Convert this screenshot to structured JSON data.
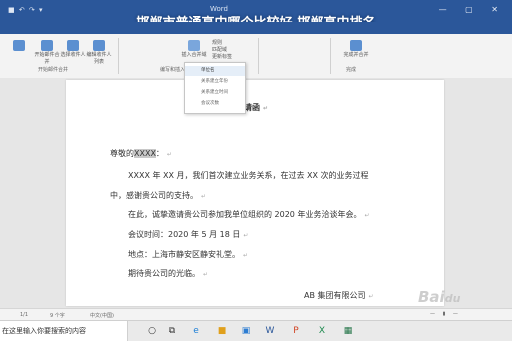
{
  "overlay_title": "邯郸市普通高中哪个比较好,邯郸高中排名",
  "window": {
    "title": "Word"
  },
  "ribbon": {
    "buttons": [
      "开始邮件合并",
      "选择收件人",
      "编辑收件人列表",
      "插入合并域"
    ],
    "group_labels": [
      "开始邮件合并",
      "编写和插入域",
      "完成"
    ],
    "right_items": [
      "规则",
      "匹配域",
      "更新标签"
    ],
    "finish_label": "完成并合并"
  },
  "dropdown": {
    "items": [
      "单位名",
      "关系建立年份",
      "关系建立时间",
      "会议次数"
    ],
    "selected_index": 0
  },
  "document": {
    "title": "邀请函",
    "salutation_prefix": "尊敬的",
    "salutation_field": "XXXX",
    "salutation_suffix": "：",
    "para1_line1": "XXXX 年 XX 月，我们首次建立业务关系，在过去 XX 次的业务过程",
    "para1_line2": "中，感谢贵公司的支持。",
    "para2": "在此，诚挚邀请贵公司参加我单位组织的 2020 年业务洽谈年会。",
    "time_line": "会议时间：2020 年 5 月 18 日",
    "place_line": "地点：上海市静安区静安礼堂。",
    "closing": "期待贵公司的光临。",
    "signature": "AB 集团有限公司"
  },
  "statusbar": {
    "page": "1/1",
    "words": "9 个字",
    "language": "中文(中国)"
  },
  "taskbar": {
    "search_text": "在这里输入你要搜索的内容"
  },
  "watermark": {
    "text": "Bai",
    "alt": "Baidu watermark logo"
  },
  "colors": {
    "accent": "#2b579a",
    "page": "#ffffff",
    "canvas": "#e6e6e6"
  }
}
